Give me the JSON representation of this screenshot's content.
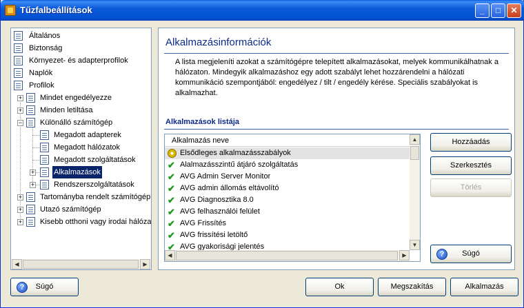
{
  "window": {
    "title": "Tűzfalbeállítások",
    "minimize_label": "_",
    "maximize_label": "□",
    "close_label": "✕"
  },
  "tree": {
    "items": [
      {
        "label": "Általános"
      },
      {
        "label": "Biztonság"
      },
      {
        "label": "Környezet- és adapterprofilok"
      },
      {
        "label": "Naplók"
      },
      {
        "label": "Profilok"
      },
      {
        "label": "Mindet engedélyezze"
      },
      {
        "label": "Minden letiltása"
      },
      {
        "label": "Különálló számítógép"
      },
      {
        "label": "Megadott adapterek"
      },
      {
        "label": "Megadott hálózatok"
      },
      {
        "label": "Megadott szolgáltatások"
      },
      {
        "label": "Alkalmazások"
      },
      {
        "label": "Rendszerszolgáltatások"
      },
      {
        "label": "Tartományba rendelt számítógép"
      },
      {
        "label": "Utazó számítógép"
      },
      {
        "label": "Kisebb otthoni vagy irodai hálózat"
      }
    ],
    "selected_index": 11
  },
  "content": {
    "heading": "Alkalmazásinformációk",
    "description": "A lista megjeleníti azokat a számítógépre telepített alkalmazásokat, melyek kommunikálhatnak a hálózaton. Mindegyik alkalmazáshoz egy adott szabályt lehet hozzárendelni a hálózati kommunikáció szempontjából: engedélyez / tilt / engedély kérése. Speciális szabályokat is alkalmazhat.",
    "list_section_label": "Alkalmazások listája",
    "list_header": "Alkalmazás neve",
    "apps": [
      {
        "label": "Elsődleges alkalmazásszabályok",
        "icon": "gear-icon"
      },
      {
        "label": "Alalmazásszintű átjáró szolgáltatás",
        "icon": "check-icon"
      },
      {
        "label": "AVG Admin Server Monitor",
        "icon": "check-icon"
      },
      {
        "label": "AVG admin állomás eltávolító",
        "icon": "check-icon"
      },
      {
        "label": "AVG Diagnosztika 8.0",
        "icon": "check-icon"
      },
      {
        "label": "AVG felhasználói felület",
        "icon": "check-icon"
      },
      {
        "label": "AVG Frissítés",
        "icon": "check-icon"
      },
      {
        "label": "AVG frissítési letöltő",
        "icon": "check-icon"
      },
      {
        "label": "AVG gyakorisági jelentés",
        "icon": "check-icon"
      }
    ],
    "buttons": {
      "add": "Hozzáadás",
      "edit": "Szerkesztés",
      "delete": "Törlés",
      "help": "Súgó"
    }
  },
  "footer": {
    "help": "Súgó",
    "ok": "Ok",
    "cancel": "Megszakítás",
    "apply": "Alkalmazás"
  },
  "colors": {
    "title_bar": "#0b5ad9",
    "selection": "#0a246a",
    "heading": "#0b2a8a",
    "check": "#1f9a1f"
  }
}
